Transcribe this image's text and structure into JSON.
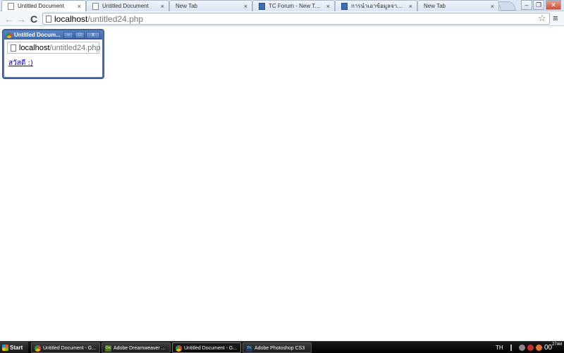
{
  "tabs": [
    {
      "label": "Untitled Document",
      "active": true,
      "icon": "page-icon"
    },
    {
      "label": "Untitled Document",
      "active": false,
      "icon": "page-icon"
    },
    {
      "label": "New Tab",
      "active": false,
      "icon": "none"
    },
    {
      "label": "TC Forum - New Topic :: เว็บ",
      "active": false,
      "icon": "forum-icon"
    },
    {
      "label": "การนำเอาข้อมูลจากฐานข้อมูล",
      "active": false,
      "icon": "forum-icon"
    },
    {
      "label": "New Tab",
      "active": false,
      "icon": "none"
    }
  ],
  "tab_close_glyph": "×",
  "window_controls": {
    "minimize": "–",
    "restore": "❐",
    "close": "✕"
  },
  "toolbar": {
    "back": "←",
    "forward": "→",
    "reload": "C",
    "url_host": "localhost",
    "url_path": "/untitled24.php",
    "star": "☆",
    "menu": "≡"
  },
  "popup": {
    "title": "Untitled Docum...",
    "minimize": "–",
    "restore": "□",
    "close": "x",
    "url_host": "localhost",
    "url_path": "/untitled24.php",
    "link_text": "สวัสดี :)"
  },
  "taskbar": {
    "start": "Start",
    "tasks": [
      {
        "label": "Untitled Document - G...",
        "icon": "chrome",
        "active": false
      },
      {
        "label": "Adobe Dreamweaver ...",
        "icon": "dw",
        "active": false
      },
      {
        "label": "Untitled Document - G...",
        "icon": "chrome",
        "active": true
      },
      {
        "label": "Adobe Photoshop CS3",
        "icon": "ps",
        "active": false
      }
    ],
    "dw_icon_text": "Dw",
    "ps_icon_text": "Ps",
    "language": "TH",
    "clock": "00",
    "clock_minutes": "27",
    "clock_ampm": "AM"
  }
}
